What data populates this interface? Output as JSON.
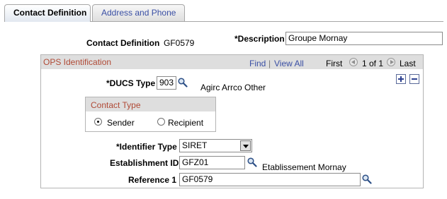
{
  "tabs": [
    {
      "label": "Contact Definition",
      "active": true
    },
    {
      "label": "Address and Phone",
      "active": false
    }
  ],
  "header": {
    "contact_definition_label": "Contact Definition",
    "contact_definition_value": "GF0579",
    "description_label": "*Description",
    "description_value": "Groupe Mornay"
  },
  "ops": {
    "title": "OPS Identification",
    "find_label": "Find",
    "separator": "|",
    "view_all_label": "View All",
    "first_label": "First",
    "page_info": "1 of 1",
    "last_label": "Last",
    "ducs_type_label": "*DUCS Type",
    "ducs_type_value": "903",
    "ducs_type_description": "Agirc Arrco Other",
    "contact_type": {
      "title": "Contact Type",
      "options": [
        {
          "label": "Sender",
          "selected": true
        },
        {
          "label": "Recipient",
          "selected": false
        }
      ]
    },
    "identifier_type_label": "*Identifier Type",
    "identifier_type_value": "SIRET",
    "establishment_id_label": "Establishment ID",
    "establishment_id_value": "GFZ01",
    "establishment_description": "Etablissement Mornay",
    "reference_label": "Reference 1",
    "reference_value": "GF0579"
  },
  "colors": {
    "link": "#3a4fa4",
    "group_title": "#b04a36",
    "header_band": "#dedede"
  }
}
